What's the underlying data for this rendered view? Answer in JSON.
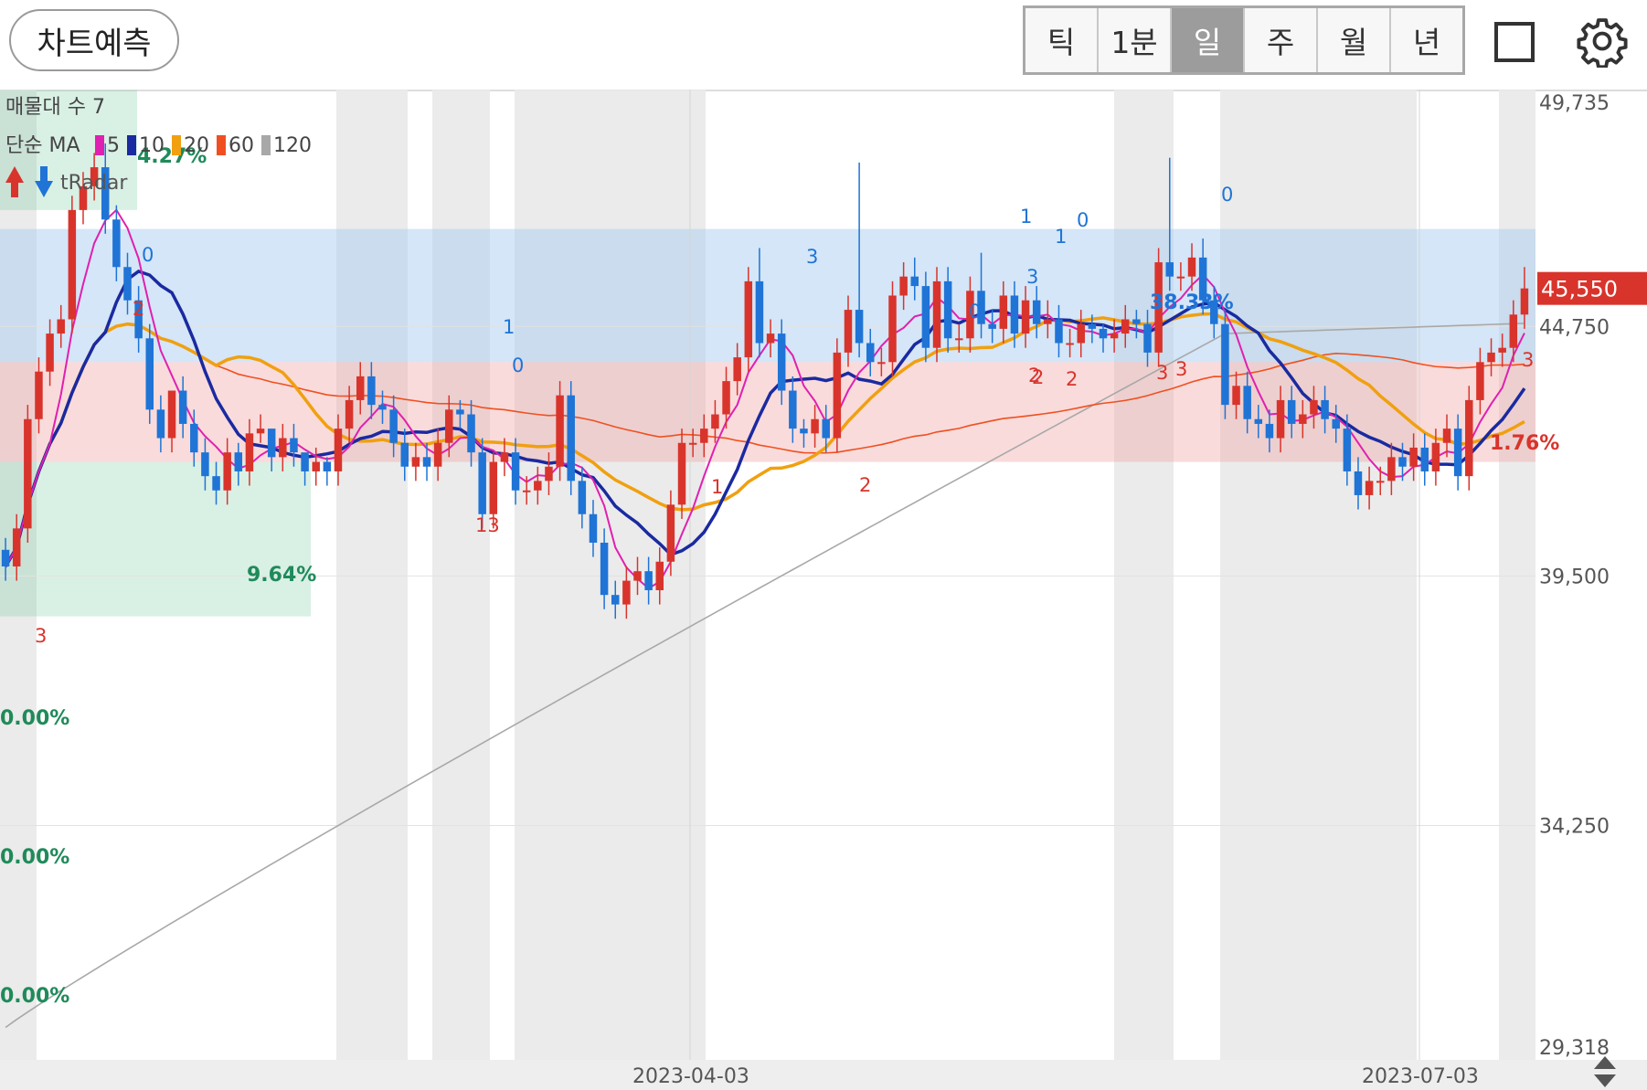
{
  "toolbar": {
    "predict_label": "차트예측",
    "periods": [
      "틱",
      "1분",
      "일",
      "주",
      "월",
      "년"
    ],
    "active_period": "일"
  },
  "colors": {
    "up": "#d8342c",
    "down": "#1f74d6",
    "ma5": "#e020b0",
    "ma10": "#1a2aa0",
    "ma20": "#f0a010",
    "ma60": "#f05020",
    "ma120": "#a8a8a8"
  },
  "indicators": {
    "volume_profile": "매물대 수 7",
    "ma_prefix": "단순 MA",
    "ma_periods": [
      "5",
      "10",
      "20",
      "60",
      "120"
    ],
    "trading_signal": "tRadar"
  },
  "chart_data": {
    "type": "candlestick",
    "ylim": [
      29318,
      49735
    ],
    "y_ticks": [
      "49,735",
      "44,750",
      "39,500",
      "34,250",
      "29,318"
    ],
    "x_ticks": [
      "2023-04-03",
      "2023-07-03"
    ],
    "current_price": "45,550",
    "zones": [
      {
        "type": "profile-low",
        "from": 41900,
        "to": 44000
      },
      {
        "type": "profile-high",
        "from": 44000,
        "to": 46800
      }
    ],
    "percent_labels": [
      "4.27%",
      "9.64%",
      "0.00%",
      "0.00%",
      "0.00%",
      "38.33%",
      "1.76%"
    ],
    "signal_marks": [
      "3",
      "2",
      "0",
      "13",
      "1",
      "0",
      "1",
      "3",
      "2",
      "0",
      "2",
      "3",
      "1",
      "1",
      "0",
      "3",
      "2",
      "2",
      "3",
      "0",
      "3"
    ],
    "series": [
      {
        "name": "candles",
        "o": [
          40050,
          39700,
          40500,
          42800,
          43800,
          44600,
          44900,
          47200,
          47700,
          48100,
          47000,
          46000,
          45300,
          44500,
          43000,
          42400,
          43400,
          42700,
          42100,
          41600,
          41300,
          42100,
          41700,
          42500,
          42600,
          42000,
          42400,
          42100,
          41700,
          41900,
          41700,
          42600,
          43200,
          43700,
          43100,
          43000,
          42300,
          41800,
          42000,
          41800,
          42300,
          43000,
          42900,
          42100,
          40800,
          41900,
          42100,
          41300,
          41300,
          41500,
          41800,
          43300,
          41500,
          40800,
          40200,
          39100,
          38900,
          39400,
          39600,
          39200,
          39800,
          41000,
          42300,
          42300,
          42600,
          42900,
          43600,
          44100,
          45700,
          44400,
          44600,
          43400,
          42600,
          42500,
          42800,
          42400,
          44200,
          45100,
          44400,
          44000,
          44000,
          45400,
          45800,
          45600,
          44300,
          45700,
          44500,
          44500,
          45500,
          44800,
          44700,
          45400,
          44600,
          45300,
          44800,
          44900,
          44400,
          44400,
          44800,
          44700,
          44500,
          44600,
          44900,
          44800,
          44200,
          46100,
          45800,
          45800,
          46200,
          45300,
          44800,
          43100,
          43500,
          42800,
          42700,
          42400,
          43200,
          42700,
          42900,
          43200,
          42800,
          42600,
          41700,
          41200,
          41500,
          41500,
          42000,
          41800,
          42200,
          41700,
          42300,
          42600,
          41600,
          43200,
          44000,
          44200,
          44300,
          45000
        ],
        "c": [
          39700,
          40500,
          42800,
          43800,
          44600,
          44900,
          47200,
          47700,
          48100,
          47000,
          46000,
          45300,
          44500,
          43000,
          42400,
          43400,
          42700,
          42100,
          41600,
          41300,
          42100,
          41700,
          42500,
          42600,
          42000,
          42400,
          42100,
          41700,
          41900,
          41700,
          42600,
          43200,
          43700,
          43100,
          43000,
          42300,
          41800,
          42000,
          41800,
          42300,
          43000,
          42900,
          42100,
          40800,
          41900,
          42100,
          41300,
          41300,
          41500,
          41800,
          43300,
          41500,
          40800,
          40200,
          39100,
          38900,
          39400,
          39600,
          39200,
          39800,
          41000,
          42300,
          42300,
          42600,
          42900,
          43600,
          44100,
          45700,
          44400,
          44600,
          43400,
          42600,
          42500,
          42800,
          42400,
          44200,
          45100,
          44400,
          44000,
          44000,
          45400,
          45800,
          45600,
          44300,
          45700,
          44500,
          44500,
          45500,
          44800,
          44700,
          45400,
          44600,
          45300,
          44800,
          44900,
          44400,
          44400,
          44800,
          44700,
          44500,
          44600,
          44900,
          44800,
          44200,
          46100,
          45800,
          45800,
          46200,
          45300,
          44800,
          43100,
          43500,
          42800,
          42700,
          42400,
          43200,
          42700,
          42900,
          43200,
          42800,
          42600,
          41700,
          41200,
          41500,
          41500,
          42000,
          41800,
          42200,
          41700,
          42300,
          42600,
          41600,
          43200,
          44000,
          44200,
          44300,
          45000,
          45550
        ],
        "h": [
          40300,
          40800,
          43100,
          44100,
          44900,
          45200,
          47500,
          48000,
          48400,
          48600,
          47300,
          46300,
          45600,
          44800,
          43300,
          42700,
          43700,
          43000,
          42400,
          41900,
          42400,
          42300,
          42800,
          42900,
          42300,
          42700,
          42700,
          42000,
          42200,
          42000,
          42900,
          43500,
          44000,
          44000,
          43400,
          43300,
          42600,
          42300,
          42300,
          42600,
          43300,
          43200,
          43200,
          42400,
          42100,
          42400,
          42400,
          41600,
          41800,
          42100,
          43600,
          43600,
          41800,
          41100,
          40500,
          39400,
          39700,
          39900,
          39900,
          40100,
          41300,
          42600,
          42600,
          42900,
          43200,
          43900,
          44400,
          46000,
          46400,
          44900,
          44900,
          43700,
          42800,
          43100,
          43100,
          44500,
          45400,
          48200,
          44700,
          44300,
          45700,
          46100,
          46200,
          45900,
          46000,
          46000,
          44800,
          45800,
          46300,
          45100,
          45700,
          45700,
          45600,
          45600,
          45300,
          45200,
          44700,
          45100,
          45000,
          44800,
          44900,
          45200,
          45100,
          45100,
          46400,
          48300,
          46100,
          46500,
          46600,
          45600,
          45100,
          43800,
          43800,
          43100,
          43000,
          43500,
          43500,
          43200,
          43500,
          43500,
          43100,
          42900,
          42000,
          41800,
          41800,
          42300,
          42300,
          42500,
          42500,
          42600,
          42900,
          42900,
          43500,
          44300,
          44500,
          44600,
          45300,
          46000
        ],
        "l": [
          39400,
          39400,
          40200,
          42500,
          43500,
          44300,
          44600,
          46900,
          47400,
          46700,
          45700,
          45000,
          44200,
          42700,
          42100,
          42100,
          42400,
          41800,
          41300,
          41000,
          41000,
          41400,
          41400,
          42300,
          41700,
          41700,
          41800,
          41400,
          41400,
          41400,
          41400,
          42300,
          42900,
          42800,
          42700,
          42000,
          41500,
          41500,
          41500,
          41500,
          42000,
          42600,
          41800,
          40500,
          40500,
          41600,
          41000,
          41000,
          41000,
          41200,
          41500,
          41200,
          40500,
          39900,
          38800,
          38600,
          38600,
          39100,
          38900,
          38900,
          39500,
          40700,
          42000,
          42000,
          42300,
          42600,
          43300,
          43800,
          44100,
          44100,
          43100,
          42300,
          42200,
          42200,
          42100,
          42100,
          43900,
          44100,
          43700,
          43700,
          43700,
          45100,
          45300,
          44000,
          44000,
          44200,
          44200,
          44200,
          44500,
          44400,
          44400,
          44300,
          44300,
          44500,
          44500,
          44100,
          44100,
          44100,
          44400,
          44200,
          44200,
          44300,
          44500,
          43900,
          43900,
          45500,
          45500,
          45500,
          45000,
          44500,
          42800,
          42800,
          42500,
          42400,
          42100,
          42100,
          42400,
          42400,
          42600,
          42500,
          42300,
          41400,
          40900,
          40900,
          41200,
          41200,
          41500,
          41500,
          41400,
          41400,
          42000,
          41300,
          41300,
          42900,
          43700,
          43900,
          44000,
          44700
        ]
      }
    ]
  }
}
